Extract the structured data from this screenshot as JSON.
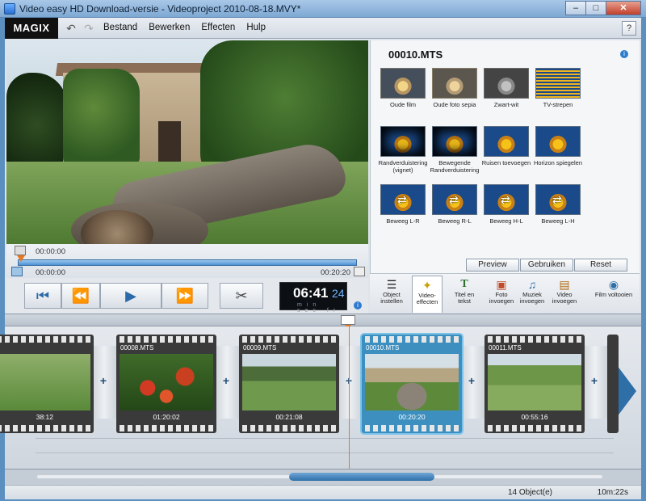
{
  "window": {
    "title": "Video easy HD Download-versie - Videoproject 2010-08-18.MVY*"
  },
  "menubar": {
    "logo": "MAGIX",
    "menus": [
      "Bestand",
      "Bewerken",
      "Effecten",
      "Hulp"
    ],
    "help": "?"
  },
  "preview": {
    "time_top": "00:00:00",
    "time_start": "00:00:00",
    "time_end": "00:20:20",
    "clock_main": "06:41",
    "clock_frames": "24",
    "clock_units": "min sec fr"
  },
  "effects": {
    "title": "00010.MTS",
    "items": [
      {
        "label": "Oude film",
        "style": "oldfilm"
      },
      {
        "label": "Oude foto sepia",
        "style": "sepia"
      },
      {
        "label": "Zwart-wit",
        "style": "bw"
      },
      {
        "label": "TV-strepen",
        "style": "tv"
      },
      {
        "label": "Randverduistering (vignet)",
        "style": "vignet"
      },
      {
        "label": "Bewegende Randverduistering",
        "style": "vignet"
      },
      {
        "label": "Ruisen toevoegen",
        "style": ""
      },
      {
        "label": "Horizon spiegelen",
        "style": ""
      },
      {
        "label": "Beweeg L-R",
        "style": "move"
      },
      {
        "label": "Beweeg R-L",
        "style": "move"
      },
      {
        "label": "Beweeg H-L",
        "style": "move"
      },
      {
        "label": "Beweeg L-H",
        "style": "move"
      }
    ],
    "buttons": {
      "preview": "Preview",
      "use": "Gebruiken",
      "reset": "Reset"
    }
  },
  "tools": [
    {
      "label": "Object instellen",
      "icon": "sliders-icon"
    },
    {
      "label": "Video-effecten",
      "icon": "wand-icon"
    },
    {
      "label": "Titel en tekst",
      "icon": "text-icon"
    },
    {
      "label": "Foto invoegen",
      "icon": "photo-icon"
    },
    {
      "label": "Muziek invoegen",
      "icon": "music-icon"
    },
    {
      "label": "Video invoegen",
      "icon": "video-icon"
    },
    {
      "label": "Film voltooien",
      "icon": "disc-icon"
    }
  ],
  "storyboard": {
    "clips": [
      {
        "name": "",
        "duration": "38:12"
      },
      {
        "name": "00008.MTS",
        "duration": "01:20:02"
      },
      {
        "name": "00009.MTS",
        "duration": "00:21:08"
      },
      {
        "name": "00010.MTS",
        "duration": "00:20:20"
      },
      {
        "name": "00011.MTS",
        "duration": "00:55:16"
      }
    ]
  },
  "status": {
    "objects": "14 Object(e)",
    "total": "10m:22s"
  },
  "colors": {
    "accent": "#2e6fa8",
    "playhead": "#e8781e"
  }
}
